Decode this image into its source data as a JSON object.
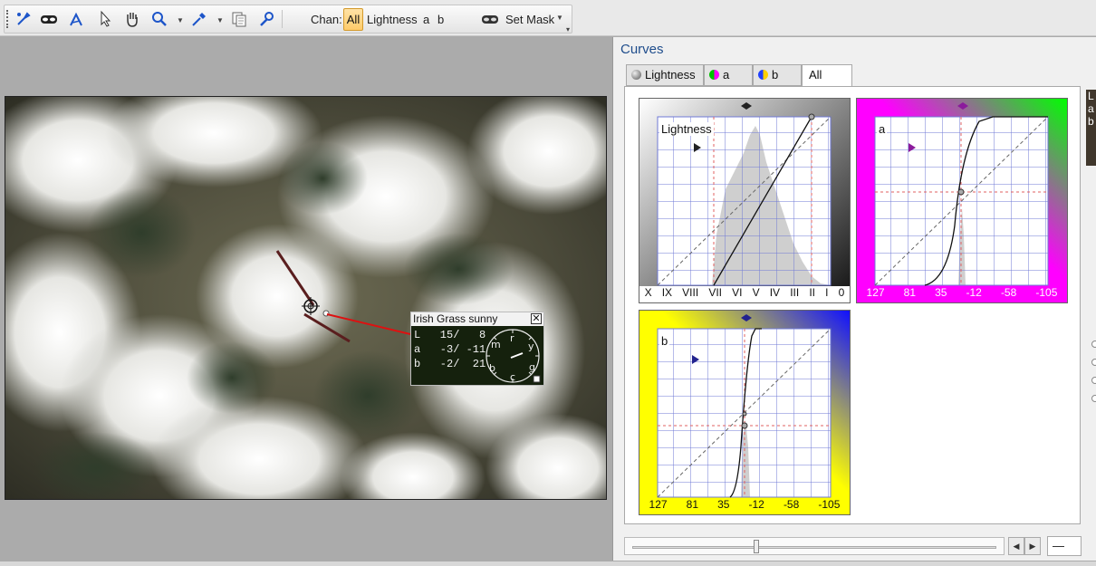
{
  "toolbar": {
    "chan_label": "Chan:",
    "chan_active": "All",
    "chan_options": [
      "Lightness",
      "a",
      "b"
    ],
    "set_mask_label": "Set Mask",
    "icons": [
      "eyedropper-icon",
      "mask-icon",
      "pen-icon",
      "pointer-icon",
      "hand-icon",
      "zoom-icon",
      "dropper-icon",
      "copy-icon",
      "wrench-icon"
    ]
  },
  "sample": {
    "title": "Irish Grass  sunny",
    "rows": [
      "L   15/   8",
      "a   -3/ -11",
      "b   -2/  21"
    ],
    "close": "✕",
    "dial_letters": [
      "m",
      "r",
      "y",
      "b",
      "c",
      "g"
    ]
  },
  "curves": {
    "title": "Curves",
    "tabs": [
      "Lightness",
      "a",
      "b",
      "All"
    ],
    "active_tab": "All",
    "lightness_label": "Lightness",
    "a_label": "a",
    "b_label": "b",
    "zone_scale": [
      "X",
      "IX",
      "VIII",
      "VII",
      "VI",
      "V",
      "IV",
      "III",
      "II",
      "I",
      "0"
    ],
    "ab_scale": [
      "127",
      "81",
      "35",
      "-12",
      "-58",
      "-105"
    ],
    "side_lines": [
      "L",
      "a",
      "b"
    ],
    "value_box": "—"
  },
  "colors": {
    "accent_title": "#1f4d8c",
    "a_left": "#ff00ff",
    "a_right": "#00ff00",
    "b_left": "#ffff00",
    "b_right": "#0000ff",
    "chan_highlight": "#ffcb6a"
  }
}
